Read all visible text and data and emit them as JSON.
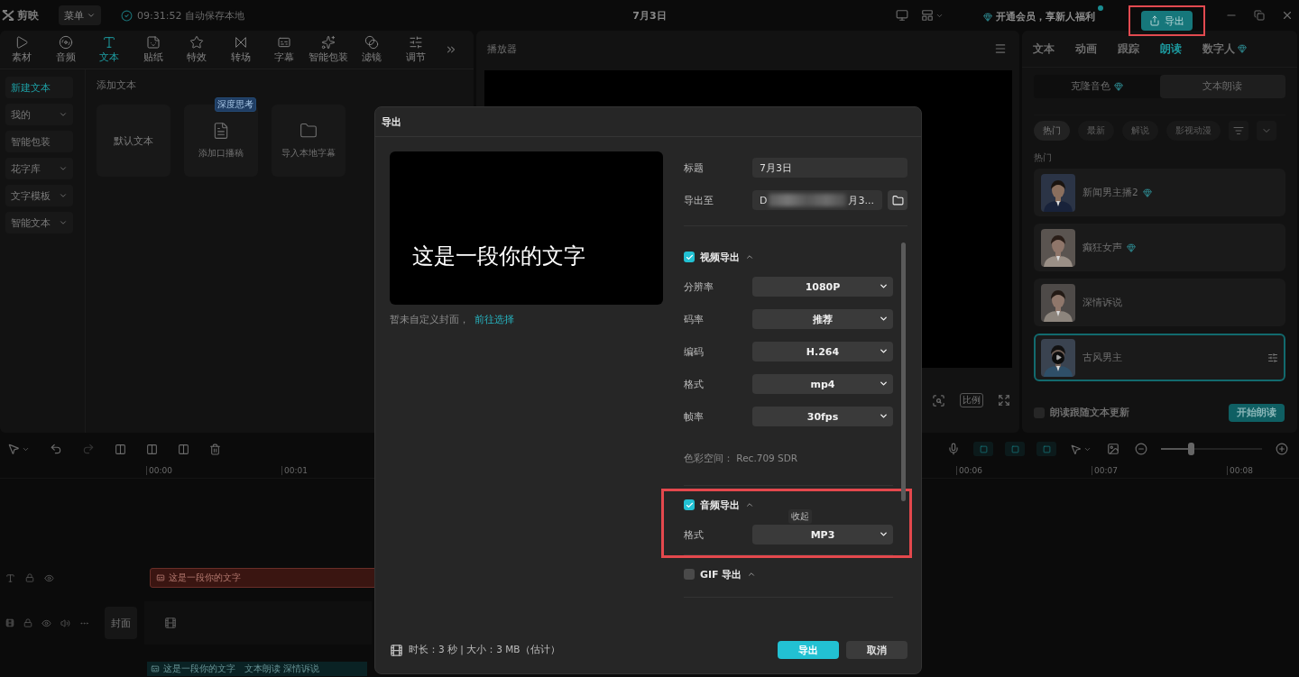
{
  "topbar": {
    "logo": "剪映",
    "menu": "菜单",
    "autosave": "09:31:52 自动保存本地",
    "project_title": "7月3日",
    "vip": "开通会员，享新人福利",
    "export": "导出",
    "export_highlighted": true
  },
  "media_tabs": [
    {
      "label": "素材",
      "selected": false
    },
    {
      "label": "音频",
      "selected": false
    },
    {
      "label": "文本",
      "selected": true
    },
    {
      "label": "贴纸",
      "selected": false
    },
    {
      "label": "特效",
      "selected": false
    },
    {
      "label": "转场",
      "selected": false
    },
    {
      "label": "字幕",
      "selected": false
    },
    {
      "label": "智能包装",
      "selected": false
    },
    {
      "label": "滤镜",
      "selected": false
    },
    {
      "label": "调节",
      "selected": false
    }
  ],
  "text_sidebar": [
    {
      "label": "新建文本",
      "selected": true,
      "expandable": false
    },
    {
      "label": "我的",
      "selected": false,
      "expandable": true
    },
    {
      "label": "智能包装",
      "selected": false,
      "expandable": false
    },
    {
      "label": "花字库",
      "selected": false,
      "expandable": true
    },
    {
      "label": "文字模板",
      "selected": false,
      "expandable": true
    },
    {
      "label": "智能文本",
      "selected": false,
      "expandable": true
    }
  ],
  "add_text": {
    "heading": "添加文本",
    "cards": [
      {
        "kind": "default",
        "label": "默认文本"
      },
      {
        "kind": "script",
        "label": "添加口播稿",
        "badge": "深度思考"
      },
      {
        "kind": "import",
        "label": "导入本地字幕"
      }
    ]
  },
  "player": {
    "title": "播放器",
    "ratio": "比例"
  },
  "inspector": {
    "tabs": [
      {
        "label": "文本",
        "selected": false,
        "premium": false
      },
      {
        "label": "动画",
        "selected": false,
        "premium": false
      },
      {
        "label": "跟踪",
        "selected": false,
        "premium": false
      },
      {
        "label": "朗读",
        "selected": true,
        "premium": false
      },
      {
        "label": "数字人",
        "selected": false,
        "premium": true
      }
    ],
    "modes": [
      {
        "label": "克隆音色",
        "selected": false,
        "premium": true
      },
      {
        "label": "文本朗读",
        "selected": true,
        "premium": false
      }
    ],
    "filters": [
      {
        "label": "热门",
        "selected": true
      },
      {
        "label": "最新",
        "selected": false
      },
      {
        "label": "解说",
        "selected": false
      },
      {
        "label": "影视动漫",
        "selected": false
      }
    ],
    "section": "热门",
    "voices": [
      {
        "name": "新闻男主播2",
        "premium": true,
        "selected": false
      },
      {
        "name": "癫狂女声",
        "premium": true,
        "selected": false
      },
      {
        "name": "深情诉说",
        "premium": false,
        "selected": false
      },
      {
        "name": "古风男主",
        "premium": false,
        "selected": true
      }
    ],
    "follow_text": {
      "label": "朗读跟随文本更新",
      "checked": false
    },
    "start": "开始朗读"
  },
  "timeline": {
    "ruler_left": [
      "00:00",
      "00:01"
    ],
    "ruler_right": [
      "00:06",
      "00:07",
      "00:08"
    ],
    "zoom": {
      "level": 0.3
    },
    "text_clip": "这是一段你的文字",
    "cover": "封面",
    "tts_clip": {
      "text": "这是一段你的文字",
      "tags": "文本朗读 深情诉说"
    }
  },
  "export_dialog": {
    "title": "导出",
    "preview_text": "这是一段你的文字",
    "cover_note": "暂未自定义封面，",
    "cover_link": "前往选择",
    "title_field": {
      "label": "标题",
      "value": "7月3日"
    },
    "path_field": {
      "label": "导出至",
      "start": "D",
      "end": "月3..."
    },
    "sections": [
      {
        "kind": "video",
        "title": "视频导出",
        "checked": true,
        "highlighted": false,
        "rows": [
          {
            "label": "分辨率",
            "value": "1080P"
          },
          {
            "label": "码率",
            "value": "推荐"
          },
          {
            "label": "编码",
            "value": "H.264"
          },
          {
            "label": "格式",
            "value": "mp4"
          },
          {
            "label": "帧率",
            "value": "30fps"
          }
        ],
        "note": "色彩空间： Rec.709 SDR"
      },
      {
        "kind": "audio",
        "title": "音频导出",
        "checked": true,
        "highlighted": true,
        "tooltip": "收起",
        "rows": [
          {
            "label": "格式",
            "value": "MP3"
          }
        ]
      },
      {
        "kind": "gif",
        "title": "GIF 导出",
        "checked": false,
        "highlighted": false
      }
    ],
    "summary": "时长：3 秒 | 大小：3 MB（估计）",
    "confirm": "导出",
    "cancel": "取消"
  }
}
